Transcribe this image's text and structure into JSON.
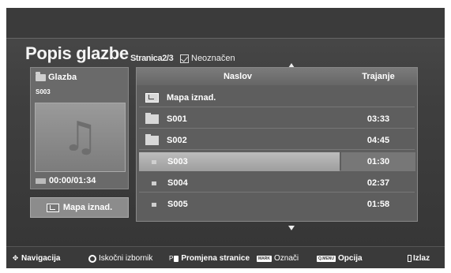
{
  "header": {
    "title": "Popis glazbe",
    "page_indicator": "Stranica2/3",
    "unmarked_label": "Neoznačen"
  },
  "left_panel": {
    "folder_label": "Glazba",
    "item_label": "S003",
    "time": "00:00/01:34",
    "up_button_label": "Mapa iznad."
  },
  "table": {
    "columns": [
      "Naslov",
      "Trajanje"
    ],
    "rows": [
      {
        "name": "Mapa iznad.",
        "duration": "",
        "icon": "up-folder-icon"
      },
      {
        "name": "S001",
        "duration": "03:33",
        "icon": "folder-icon"
      },
      {
        "name": "S002",
        "duration": "04:45",
        "icon": "folder-icon"
      },
      {
        "name": "S003",
        "duration": "01:30",
        "icon": "file-icon",
        "selected": true
      },
      {
        "name": "S004",
        "duration": "02:37",
        "icon": "file-icon"
      },
      {
        "name": "S005",
        "duration": "01:58",
        "icon": "file-icon"
      }
    ]
  },
  "footer": {
    "navigation": "Navigacija",
    "popup_menu": "Iskočni izbornik",
    "page_change_prefix": "P",
    "page_change": "Promjena stranice",
    "mark_key": "MARK",
    "mark": "Označi",
    "menu_key": "Q.MENU",
    "option": "Opcija",
    "exit": "Izlaz"
  }
}
